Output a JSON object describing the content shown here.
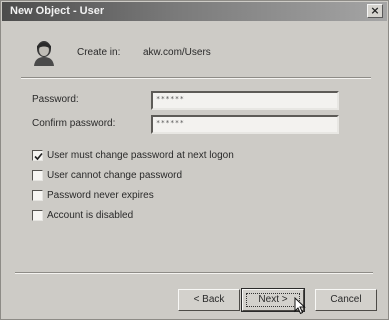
{
  "window": {
    "title": "New Object - User",
    "close_glyph": "×"
  },
  "header": {
    "icon": "user-icon",
    "create_in_label": "Create in:",
    "create_in_path": "akw.com/Users"
  },
  "fields": {
    "password_label": "Password:",
    "password_value": "******",
    "confirm_label": "Confirm password:",
    "confirm_value": "******"
  },
  "options": [
    {
      "label": "User must change password at next logon",
      "checked": true
    },
    {
      "label": "User cannot change password",
      "checked": false
    },
    {
      "label": "Password never expires",
      "checked": false
    },
    {
      "label": "Account is disabled",
      "checked": false
    }
  ],
  "buttons": {
    "back": "< Back",
    "next": "Next >",
    "cancel": "Cancel"
  }
}
